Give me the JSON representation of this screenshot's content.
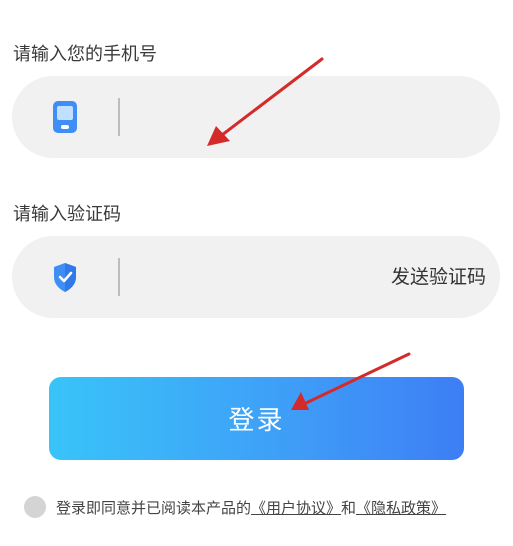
{
  "phone": {
    "label": "请输入您的手机号",
    "value": "",
    "placeholder": "",
    "icon": "phone-icon"
  },
  "code": {
    "label": "请输入验证码",
    "value": "",
    "placeholder": "",
    "icon": "shield-check-icon",
    "send_code_label": "发送验证码"
  },
  "login": {
    "label": "登录",
    "gradient_start": "#39c4f9",
    "gradient_end": "#3d7ef5"
  },
  "agreement": {
    "prefix": "登录即同意并已阅读本产品的",
    "user_agreement": "《用户协议》",
    "conjunction": "和",
    "privacy_policy": "《隐私政策》"
  },
  "annotation": {
    "arrow_color": "#d42a2a"
  }
}
